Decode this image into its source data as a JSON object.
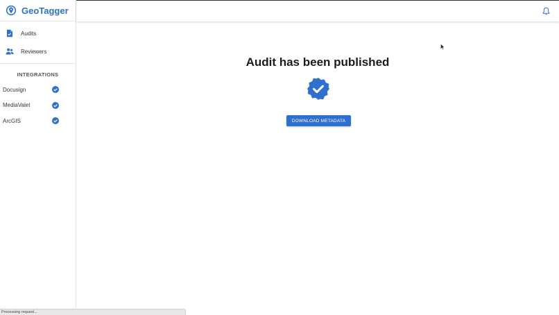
{
  "app": {
    "name": "GeoTagger"
  },
  "sidebar": {
    "nav": [
      {
        "label": "Audits",
        "icon": "audit-document-icon"
      },
      {
        "label": "Reviewers",
        "icon": "people-icon"
      }
    ],
    "integrations_title": "INTEGRATIONS",
    "integrations": [
      {
        "label": "Docusign",
        "status": "connected"
      },
      {
        "label": "MediaValet",
        "status": "connected"
      },
      {
        "label": "ArcGIS",
        "status": "connected"
      }
    ]
  },
  "main": {
    "heading": "Audit has been published",
    "badge_icon": "verified-badge-icon",
    "download_label": "DOWNLOAD METADATA"
  },
  "statusbar": {
    "text": "Processing request..."
  },
  "colors": {
    "accent": "#2f6fce",
    "text": "#1c1c1c"
  }
}
